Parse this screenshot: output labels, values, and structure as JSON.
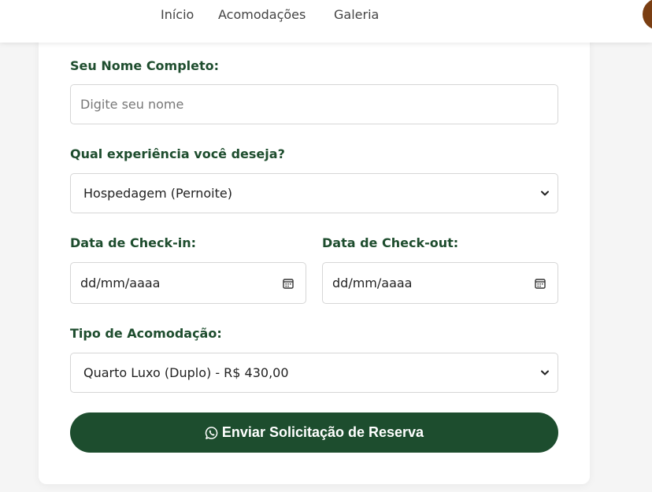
{
  "nav": {
    "items": [
      {
        "label": "Início"
      },
      {
        "label": "Acomodações"
      },
      {
        "label": "Galeria"
      }
    ]
  },
  "form": {
    "name": {
      "label": "Seu Nome Completo:",
      "placeholder": "Digite seu nome",
      "value": ""
    },
    "experience": {
      "label": "Qual experiência você deseja?",
      "selected": "Hospedagem (Pernoite)"
    },
    "checkin": {
      "label": "Data de Check-in:",
      "value": "dd/mm/aaaa"
    },
    "checkout": {
      "label": "Data de Check-out:",
      "value": "dd/mm/aaaa"
    },
    "room": {
      "label": "Tipo de Acomodação:",
      "selected": "Quarto Luxo (Duplo) - R$ 430,00"
    },
    "submit_label": "Enviar Solicitação de Reserva"
  },
  "colors": {
    "primary": "#1d4d2e",
    "label": "#1e4d2e",
    "avatar": "#7a3e12"
  },
  "icons": {
    "submit": "whatsapp-icon",
    "date": "calendar-icon",
    "select": "chevron-down-icon"
  }
}
